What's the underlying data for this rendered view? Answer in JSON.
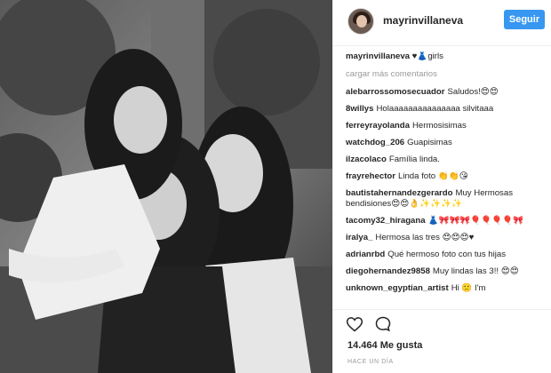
{
  "header": {
    "username": "mayrinvillaneva",
    "follow_label": "Seguir"
  },
  "caption": {
    "username": "mayrinvillaneva",
    "text": "♥👗girls"
  },
  "load_more_label": "cargar más comentarios",
  "comments": [
    {
      "user": "alebarrossomosecuador",
      "text": "Saludos!😍😍"
    },
    {
      "user": "8willys",
      "text": "Holaaaaaaaaaaaaaaa silvitaaa"
    },
    {
      "user": "ferreyrayolanda",
      "text": "Hermosisimas"
    },
    {
      "user": "watchdog_206",
      "text": "Guapisimas"
    },
    {
      "user": "ilzacolaco",
      "text": "Família linda."
    },
    {
      "user": "frayrehector",
      "text": "Linda foto 👏👏😘"
    },
    {
      "user": "bautistahernandezgerardo",
      "text": "Muy Hermosas bendisiones😍😍👌✨✨✨✨"
    },
    {
      "user": "tacomy32_hiragana",
      "text": "👗🎀🎀🎀🎈🎈🎈🎈🎀"
    },
    {
      "user": "iralya_",
      "text": "Hermosa las tres 😍😍😍♥"
    },
    {
      "user": "adrianrbd",
      "text": "Qué hermoso foto con tus hijas"
    },
    {
      "user": "diegohernandez9858",
      "text": "Muy lindas las 3!! 😍😍"
    },
    {
      "user": "unknown_egyptian_artist",
      "text": "Hi 🙂 I'm"
    }
  ],
  "likes_text": "14.464 Me gusta",
  "time_text": "HACE UN DÍA",
  "icons": {
    "like": "heart-icon",
    "comment": "comment-bubble-icon"
  }
}
